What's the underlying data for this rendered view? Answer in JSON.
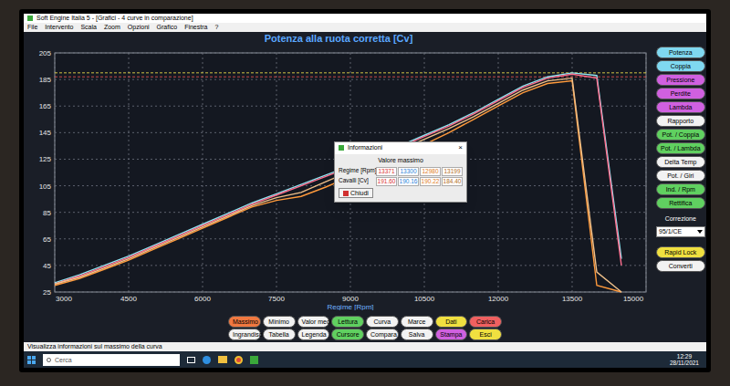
{
  "window": {
    "title": "Soft Engine Italia 5 - [Grafici - 4 curve in comparazione]"
  },
  "menu": [
    "File",
    "Intervento",
    "Scala",
    "Zoom",
    "Opzioni",
    "Grafico",
    "Finestra",
    "?"
  ],
  "chart": {
    "title": "Potenza alla ruota corretta [Cv]",
    "x_label": "Regime [Rpm]",
    "y_ticks": [
      "205",
      "185",
      "165",
      "145",
      "125",
      "105",
      "85",
      "65",
      "45",
      "25"
    ],
    "x_ticks": [
      "3000",
      "4500",
      "6000",
      "7500",
      "9000",
      "10500",
      "12000",
      "13500",
      "15000"
    ],
    "rpm": [
      3000,
      3500,
      4000,
      4500,
      5000,
      5500,
      6000,
      6500,
      7000,
      7500,
      8000,
      8500,
      9000,
      9500,
      10000,
      10500,
      11000,
      11500,
      12000,
      12500,
      13000,
      13500,
      14000,
      14500
    ],
    "series": [
      {
        "color": "#8fe3f0",
        "values": [
          32,
          38,
          45,
          52,
          60,
          68,
          76,
          84,
          92,
          99,
          106,
          113,
          120,
          127,
          135,
          143,
          151,
          160,
          170,
          180,
          187,
          190,
          188,
          50
        ]
      },
      {
        "color": "#ff6f8f",
        "values": [
          31,
          37,
          44,
          51,
          59,
          67,
          75,
          83,
          91,
          98,
          105,
          112,
          119,
          126,
          134,
          142,
          150,
          159,
          169,
          179,
          186,
          189,
          186,
          45
        ]
      },
      {
        "color": "#ff9a3c",
        "values": [
          30,
          35,
          42,
          49,
          57,
          65,
          73,
          81,
          89,
          94,
          97,
          104,
          112,
          120,
          128,
          136,
          145,
          155,
          165,
          175,
          182,
          184,
          30,
          25
        ]
      },
      {
        "color": "#f0c08a",
        "values": [
          31,
          36,
          43,
          50,
          58,
          66,
          74,
          82,
          90,
          96,
          100,
          108,
          116,
          124,
          132,
          140,
          148,
          157,
          167,
          177,
          184,
          186,
          40,
          25
        ]
      }
    ],
    "reference_lines": [
      {
        "value": 190,
        "color": "#e6d84a"
      },
      {
        "value": 187,
        "color": "#e05050"
      }
    ]
  },
  "dialog": {
    "title": "Informazioni",
    "heading": "Valore massimo",
    "row_labels": [
      "Regime [Rpm]",
      "Cavalli [Cv]"
    ],
    "columns": [
      {
        "rpm": "13371",
        "cv": "191.60",
        "color": "#d93030"
      },
      {
        "rpm": "13300",
        "cv": "190.16",
        "color": "#2a7fd9"
      },
      {
        "rpm": "12980",
        "cv": "190.22",
        "color": "#e07a20"
      },
      {
        "rpm": "13199",
        "cv": "184.40",
        "color": "#b06a20"
      }
    ],
    "close_button": "Chiudi",
    "close_icon": "×"
  },
  "side_buttons": [
    {
      "label": "Potenza",
      "color": "#7fd8f0"
    },
    {
      "label": "Coppia",
      "color": "#7fd8f0"
    },
    {
      "label": "Pressione",
      "color": "#d060e0"
    },
    {
      "label": "Perdite",
      "color": "#d060e0"
    },
    {
      "label": "Lambda",
      "color": "#d060e0"
    },
    {
      "label": "Rapporto",
      "color": "#f2f2f2"
    },
    {
      "label": "Pot. / Coppia",
      "color": "#60d060"
    },
    {
      "label": "Pot. / Lambda",
      "color": "#60d060"
    },
    {
      "label": "Delta Temp",
      "color": "#f2f2f2"
    },
    {
      "label": "Pot. / Giri",
      "color": "#f2f2f2"
    },
    {
      "label": "Ind. / Rpm",
      "color": "#60d060"
    },
    {
      "label": "Rettifica",
      "color": "#60d060"
    }
  ],
  "correction": {
    "label": "Correzione",
    "value": "95/1/CE"
  },
  "extra_buttons": [
    {
      "label": "Rapid Lock",
      "color": "#f0e040"
    },
    {
      "label": "Converti",
      "color": "#f2f2f2"
    }
  ],
  "bottom_buttons": [
    {
      "label": "Massimo",
      "color": "#f07840"
    },
    {
      "label": "Minimo",
      "color": "#f2f2f2"
    },
    {
      "label": "Valor medio",
      "color": "#f2f2f2"
    },
    {
      "label": "Lettura",
      "color": "#60d060"
    },
    {
      "label": "Curva",
      "color": "#f2f2f2"
    },
    {
      "label": "Marce",
      "color": "#f2f2f2"
    },
    {
      "label": "Dati",
      "color": "#f0e040"
    },
    {
      "label": "Carica",
      "color": "#f06060"
    },
    {
      "label": "Ingrandisci",
      "color": "#f2f2f2"
    },
    {
      "label": "Tabella",
      "color": "#f2f2f2"
    },
    {
      "label": "Legenda",
      "color": "#f2f2f2"
    },
    {
      "label": "Cursore",
      "color": "#60d060"
    },
    {
      "label": "Compara",
      "color": "#f2f2f2"
    },
    {
      "label": "Salva",
      "color": "#f2f2f2"
    },
    {
      "label": "Stampa",
      "color": "#d060e0"
    },
    {
      "label": "Esci",
      "color": "#f0e040"
    }
  ],
  "status_bar": "Visualizza informazioni sul massimo della curva",
  "taskbar": {
    "search": "Cerca",
    "time": "12:29",
    "date": "28/11/2021"
  }
}
